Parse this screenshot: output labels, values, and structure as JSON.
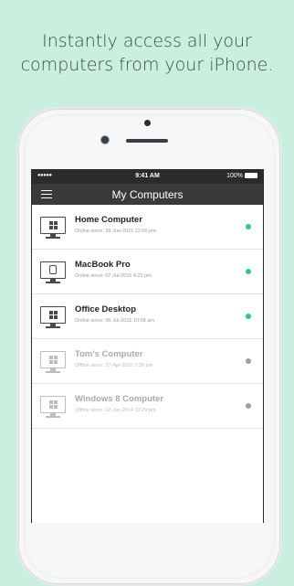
{
  "headline": {
    "line1": "Instantly access all your",
    "line2": "computers from your iPhone."
  },
  "statusbar": {
    "signal": "●●●●● ",
    "time": "9:41 AM",
    "battery": "100%"
  },
  "navbar": {
    "title": "My Computers",
    "menu_icon": "hamburger-menu-icon"
  },
  "colors": {
    "background": "#c9efdf",
    "online": "#2ecc71",
    "offline": "#9e9e9e",
    "navbar": "#3a3a3c"
  },
  "computers": [
    {
      "name": "Home Computer",
      "since": "Online since: 29-Jun-2015 12:00 pm",
      "status": "online",
      "icon": "windows-monitor-icon"
    },
    {
      "name": "MacBook Pro",
      "since": "Online since: 07-Jul-2015 4:21 pm",
      "status": "online",
      "icon": "apple-monitor-icon"
    },
    {
      "name": "Office Desktop",
      "since": "Online since: 06-Jul-2015 10:58 am",
      "status": "online",
      "icon": "windows-monitor-icon"
    },
    {
      "name": "Tom's Computer",
      "since": "Offline since: 27-Apr-2015 7:36 pm",
      "status": "offline",
      "icon": "windows-monitor-icon"
    },
    {
      "name": "Windows 8 Computer",
      "since": "Offline since: 02-Jan-2014 12:29 pm",
      "status": "offline",
      "icon": "windows-monitor-icon"
    }
  ]
}
